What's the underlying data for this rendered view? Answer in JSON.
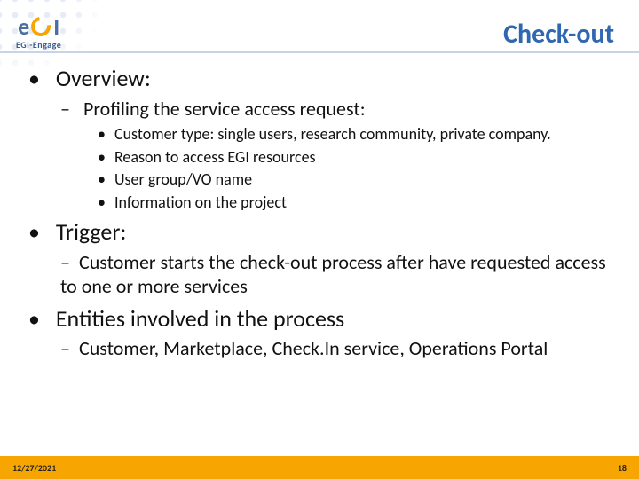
{
  "logo": {
    "text_e": "e",
    "text_i": "I",
    "subline": "EGI-Engage"
  },
  "title": "Check-out",
  "bullets": {
    "overview": {
      "label": "Overview:",
      "sub": {
        "profiling": "Profiling the service access request:",
        "items": {
          "a": "Customer type: single users, research community, private company.",
          "b": "Reason to access EGI resources",
          "c": "User group/VO name",
          "d": "Information on the project"
        }
      }
    },
    "trigger": {
      "label": "Trigger:",
      "sub": "Customer starts the check-out process after have requested access to one or more services"
    },
    "entities": {
      "label": "Entities involved in the process",
      "sub": "Customer, Marketplace, Check.In service, Operations Portal"
    }
  },
  "footer": {
    "date": "12/27/2021",
    "page": "18"
  }
}
